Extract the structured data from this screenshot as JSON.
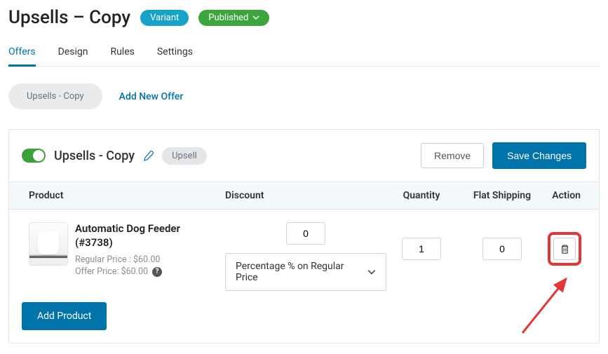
{
  "header": {
    "title": "Upsells – Copy",
    "variant_badge": "Variant",
    "status_badge": "Published"
  },
  "tabs": [
    {
      "label": "Offers",
      "active": true
    },
    {
      "label": "Design",
      "active": false
    },
    {
      "label": "Rules",
      "active": false
    },
    {
      "label": "Settings",
      "active": false
    }
  ],
  "offers_bar": {
    "current": "Upsells - Copy",
    "add_new": "Add New Offer"
  },
  "panel": {
    "toggle_on": true,
    "name": "Upsells - Copy",
    "type_tag": "Upsell",
    "remove_btn": "Remove",
    "save_btn": "Save Changes"
  },
  "table": {
    "headers": {
      "product": "Product",
      "discount": "Discount",
      "quantity": "Quantity",
      "shipping": "Flat Shipping",
      "action": "Action"
    },
    "row": {
      "product_name": "Automatic Dog Feeder",
      "product_id": "(#3738)",
      "regular_price": "Regular Price : $60.00",
      "offer_price": "Offer Price: $60.00",
      "discount_value": "0",
      "discount_type": "Percentage % on Regular Price",
      "quantity": "1",
      "shipping": "0"
    }
  },
  "footer": {
    "add_product": "Add Product"
  }
}
